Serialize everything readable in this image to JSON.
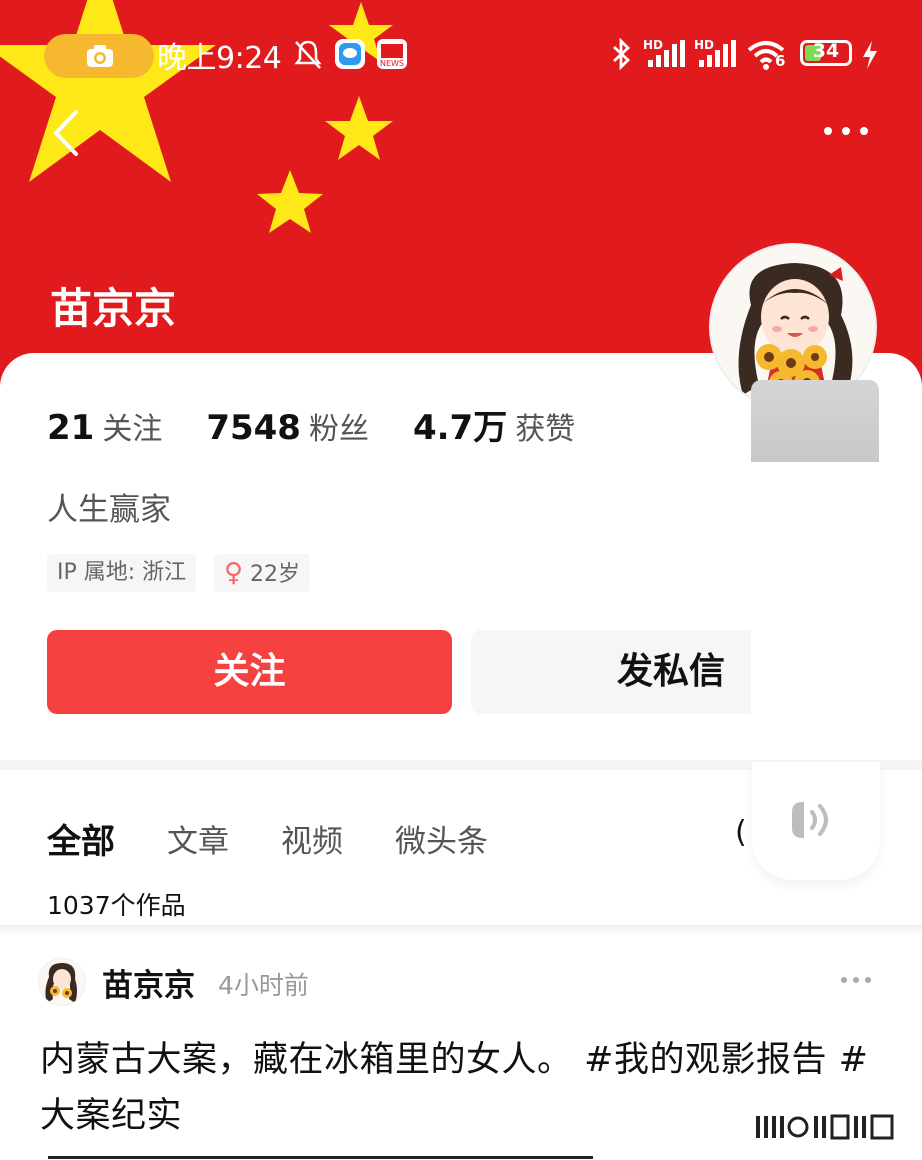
{
  "status_bar": {
    "time": "晚上9:24",
    "network_1": "HD",
    "network_2": "HD",
    "wifi": "6",
    "battery": "34"
  },
  "header": {
    "name": "苗京京"
  },
  "stats": [
    {
      "num": "21",
      "label": "关注"
    },
    {
      "num": "7548",
      "label": "粉丝"
    },
    {
      "num": "4.7万",
      "label": "获赞"
    }
  ],
  "bio": "人生赢家",
  "tags": {
    "ip": "IP 属地: 浙江",
    "gender_symbol": "♀",
    "age": "22岁"
  },
  "actions": {
    "follow": "关注",
    "message": "发私信"
  },
  "tabs": [
    "全部",
    "文章",
    "视频",
    "微头条"
  ],
  "tab_partial": "(",
  "works_count": "1037个作品",
  "post": {
    "author": "苗京京",
    "time": "4小时前",
    "text": "内蒙古大案，藏在冰箱里的女人。 #我的观影报告 #大案纪实"
  },
  "colors": {
    "flag_red": "#e11b1d",
    "star_yellow": "#ffe818",
    "follow_red": "#f5413f"
  }
}
